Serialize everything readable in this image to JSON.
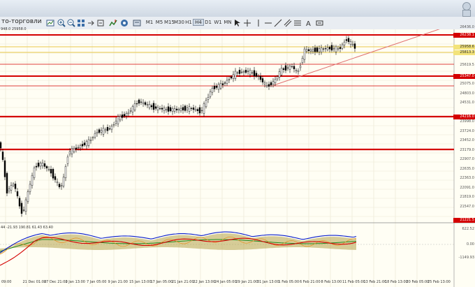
{
  "window": {
    "title_fragment": "то-торговли",
    "info_line": "948.0 25958.0"
  },
  "toolbar": {
    "timeframes": [
      "M1",
      "M5",
      "M15",
      "M30",
      "H1",
      "H4",
      "D1",
      "W1",
      "MN"
    ],
    "active_timeframe": "H4"
  },
  "price_axis": {
    "labels": [
      "26436.0",
      "26238.1",
      "25958.6",
      "25813.3",
      "25619.5",
      "25347.0",
      "25075.0",
      "24803.0",
      "24531.0",
      "24216.0",
      "23998.0",
      "23724.0",
      "23452.0",
      "23179.0",
      "22907.0",
      "22635.0",
      "22363.0",
      "22091.0",
      "21819.0",
      "21547.0",
      "21221.5"
    ],
    "red_labels": [
      "26238.1",
      "25347.0",
      "24216.0",
      "23378.0",
      "21221.5"
    ],
    "yellow_labels": [
      "25958.6",
      "25813.3"
    ]
  },
  "indicator": {
    "header": "44 -21.93 190.81 61.43 63.40",
    "axis_labels": [
      "622.52",
      "0.00",
      "-1149.93"
    ]
  },
  "date_labels": [
    "09:00",
    "21 Dec 01:00",
    "27 Dec 21:00",
    "2 Jan 13:00",
    "7 Jan 05:00",
    "9 Jan 21:00",
    "15 Jan 13:00",
    "17 Jan 05:00",
    "21 Jan 21:00",
    "22 Jan 13:00",
    "24 Jan 05:00",
    "29 Jan 21:00",
    "31 Jan 13:00",
    "1 Feb 05:00",
    "6 Feb 21:00",
    "8 Feb 13:00",
    "11 Feb 05:00",
    "13 Feb 21:00",
    "18 Feb 13:00",
    "20 Feb 05:00",
    "25 Feb 13:00"
  ],
  "colors": {
    "background": "#fffef4",
    "level_red": "#d40000",
    "level_yellow": "#e8c84a",
    "trendline": "#e07070",
    "candles": "#000000",
    "osc_blue": "#0a1ecb",
    "osc_red": "#d40000",
    "osc_green": "#1f8a1f",
    "osc_orange": "#e89020",
    "osc_fill": "#b5a24a"
  },
  "icons": [
    "new-chart-icon",
    "profiles-icon",
    "zoom-in-icon",
    "zoom-out-icon",
    "tile-windows-icon",
    "scroll-icon",
    "autoscroll-icon",
    "indicators-icon",
    "periods-icon",
    "templates-icon",
    "cursor-icon",
    "crosshair-icon",
    "vertical-line-icon",
    "horizontal-line-icon",
    "trendline-icon",
    "channel-icon",
    "fibo-icon",
    "text-icon",
    "label-icon"
  ]
}
